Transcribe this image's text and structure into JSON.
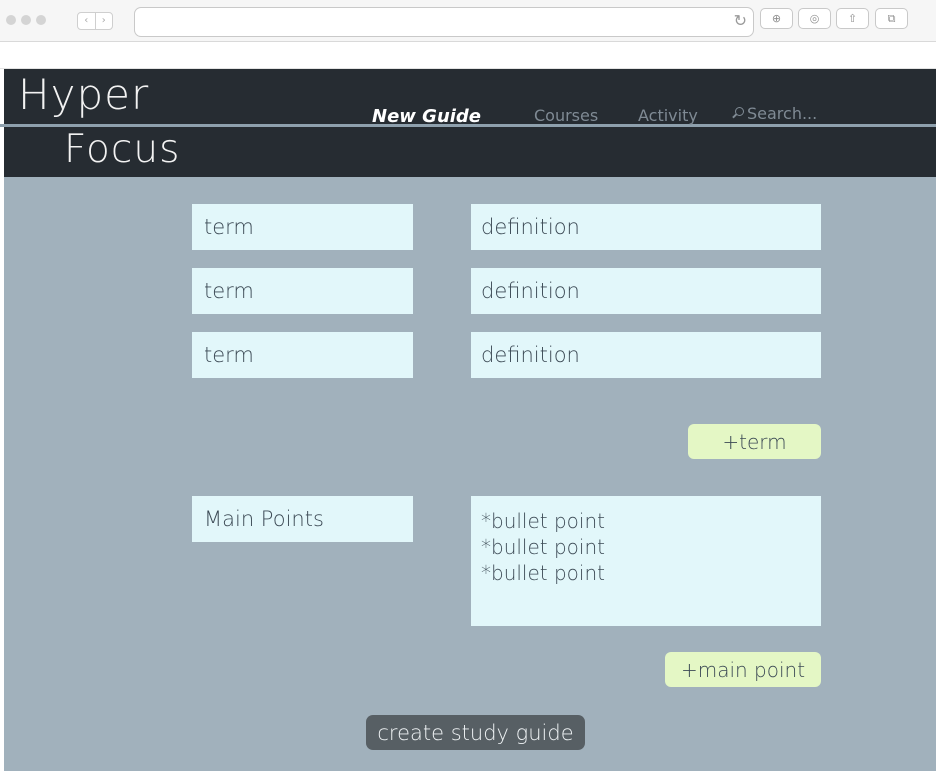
{
  "browser": {
    "back_glyph": "‹",
    "forward_glyph": "›",
    "reload_glyph": "↻",
    "toolbar_icons": [
      "download-icon",
      "account-icon",
      "share-icon",
      "tabs-icon"
    ],
    "toolbar_glyphs": [
      "⊕",
      "◎",
      "⇧",
      "⧉"
    ]
  },
  "header": {
    "logo_line1": "Hyper",
    "logo_line2": "Focus",
    "nav": {
      "new_guide": "New Guide",
      "courses": "Courses",
      "activity": "Activity",
      "search": "Search..."
    }
  },
  "form": {
    "rows": [
      {
        "term": "term",
        "definition": "definition"
      },
      {
        "term": "term",
        "definition": "definition"
      },
      {
        "term": "term",
        "definition": "definition"
      }
    ],
    "add_term": "+term",
    "main_points_label": "Main Points",
    "bullets": [
      "*bullet point",
      "*bullet point",
      "*bullet point"
    ],
    "add_main_point": "+main point",
    "create_button": "create study guide"
  },
  "colors": {
    "header_bg": "#262c32",
    "main_bg": "#a1b1bc",
    "field_bg": "#e2f7fa",
    "add_button_bg": "#e4f7c5",
    "create_button_bg": "#575f64"
  }
}
